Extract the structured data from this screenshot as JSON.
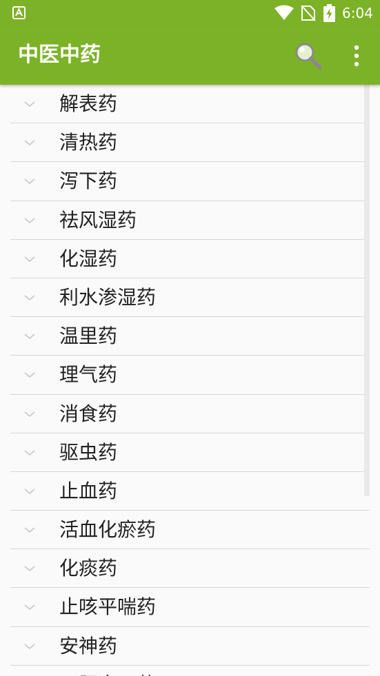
{
  "status_bar": {
    "time": "6:04",
    "app_icon": "a-notification-icon",
    "wifi_icon": "wifi-icon",
    "signal_icon": "no-sim-signal-icon",
    "battery_icon": "battery-charging-icon"
  },
  "toolbar": {
    "title": "中医中药",
    "background_color": "#7cb227",
    "search_icon": "search-icon",
    "menu_icon": "more-vert-icon"
  },
  "categories": [
    {
      "label": "解表药"
    },
    {
      "label": "清热药"
    },
    {
      "label": "泻下药"
    },
    {
      "label": "祛风湿药"
    },
    {
      "label": "化湿药"
    },
    {
      "label": "利水渗湿药"
    },
    {
      "label": "温里药"
    },
    {
      "label": "理气药"
    },
    {
      "label": "消食药"
    },
    {
      "label": "驱虫药"
    },
    {
      "label": "止血药"
    },
    {
      "label": "活血化瘀药"
    },
    {
      "label": "化痰药"
    },
    {
      "label": "止咳平喘药"
    },
    {
      "label": "安神药"
    },
    {
      "label": "平肝息风药"
    }
  ]
}
